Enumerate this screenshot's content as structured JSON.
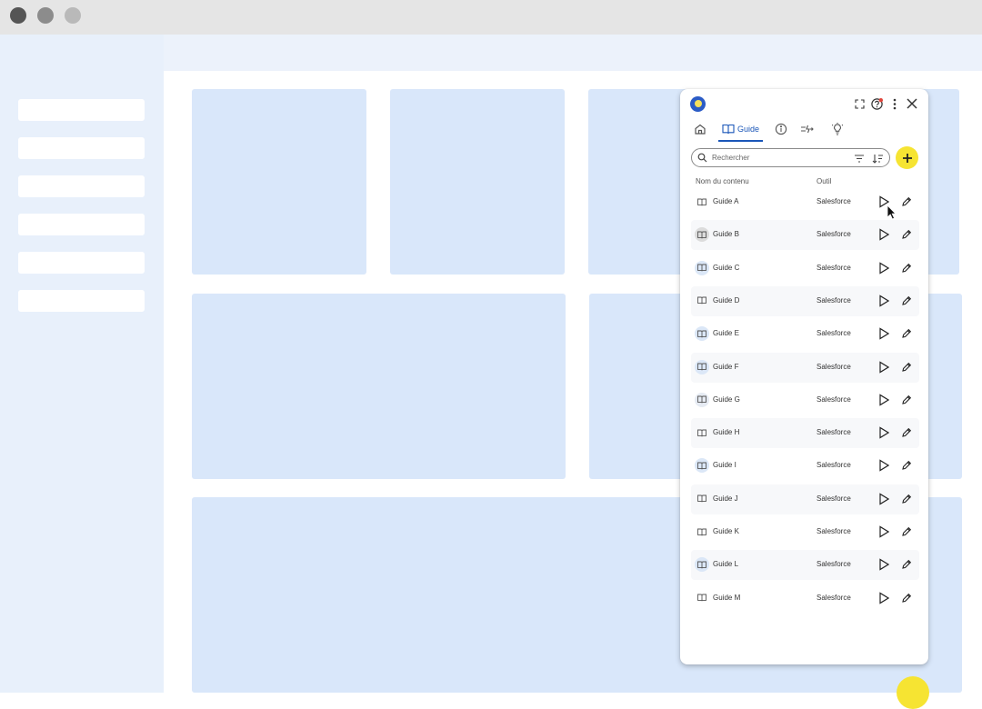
{
  "window": {
    "dots": [
      {
        "name": "close",
        "color": "#555555"
      },
      {
        "name": "minimize",
        "color": "#8c8c8c"
      },
      {
        "name": "maximize",
        "color": "#b9b9b9"
      }
    ]
  },
  "panel": {
    "tabs": [
      {
        "name": "home",
        "label": ""
      },
      {
        "name": "guide",
        "label": "Guide",
        "active": true
      },
      {
        "name": "info",
        "label": ""
      },
      {
        "name": "automation",
        "label": ""
      },
      {
        "name": "tips",
        "label": ""
      }
    ],
    "search": {
      "placeholder": "Rechercher",
      "value": ""
    },
    "columns": {
      "name": "Nom du contenu",
      "tool": "Outil"
    },
    "rows": [
      {
        "name": "Guide A",
        "tool": "Salesforce"
      },
      {
        "name": "Guide B",
        "tool": "Salesforce"
      },
      {
        "name": "Guide C",
        "tool": "Salesforce"
      },
      {
        "name": "Guide D",
        "tool": "Salesforce"
      },
      {
        "name": "Guide E",
        "tool": "Salesforce"
      },
      {
        "name": "Guide F",
        "tool": "Salesforce"
      },
      {
        "name": "Guide G",
        "tool": "Salesforce"
      },
      {
        "name": "Guide H",
        "tool": "Salesforce"
      },
      {
        "name": "Guide I",
        "tool": "Salesforce"
      },
      {
        "name": "Guide J",
        "tool": "Salesforce"
      },
      {
        "name": "Guide K",
        "tool": "Salesforce"
      },
      {
        "name": "Guide L",
        "tool": "Salesforce"
      },
      {
        "name": "Guide M",
        "tool": "Salesforce"
      }
    ]
  },
  "colors": {
    "accent": "#1a56b8",
    "add_button": "#f6e432",
    "card": "#d9e7fa",
    "sidebar": "#e8f0fb"
  }
}
